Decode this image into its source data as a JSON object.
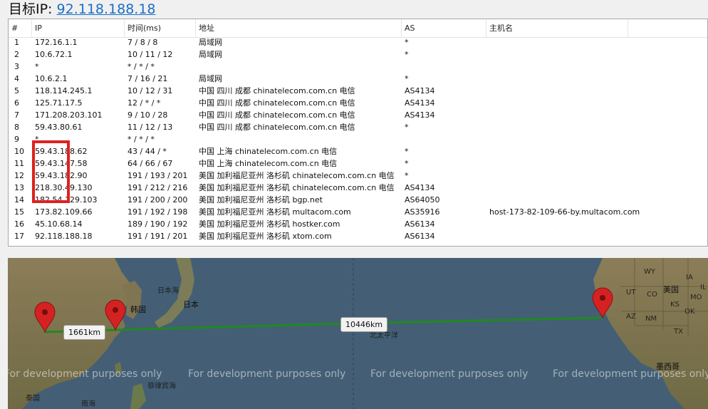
{
  "target": {
    "label": "目标IP:",
    "ip": "92.118.188.18"
  },
  "table": {
    "headers": [
      "#",
      "IP",
      "时间(ms)",
      "地址",
      "AS",
      "主机名"
    ],
    "rows": [
      {
        "n": "1",
        "ip": "172.16.1.1",
        "time": "7 / 8 / 8",
        "addr": "局域网",
        "as": "*",
        "host": ""
      },
      {
        "n": "2",
        "ip": "10.6.72.1",
        "time": "10 / 11 / 12",
        "addr": "局域网",
        "as": "*",
        "host": ""
      },
      {
        "n": "3",
        "ip": "*",
        "time": "* / * / *",
        "addr": "",
        "as": "",
        "host": ""
      },
      {
        "n": "4",
        "ip": "10.6.2.1",
        "time": "7 / 16 / 21",
        "addr": "局域网",
        "as": "*",
        "host": ""
      },
      {
        "n": "5",
        "ip": "118.114.245.1",
        "time": "10 / 12 / 31",
        "addr": "中国 四川 成都 chinatelecom.com.cn 电信",
        "as": "AS4134",
        "host": ""
      },
      {
        "n": "6",
        "ip": "125.71.17.5",
        "time": "12 / * / *",
        "addr": "中国 四川 成都 chinatelecom.com.cn 电信",
        "as": "AS4134",
        "host": ""
      },
      {
        "n": "7",
        "ip": "171.208.203.101",
        "time": "9 / 10 / 28",
        "addr": "中国 四川 成都 chinatelecom.com.cn 电信",
        "as": "AS4134",
        "host": ""
      },
      {
        "n": "8",
        "ip": "59.43.80.61",
        "time": "11 / 12 / 13",
        "addr": "中国 四川 成都 chinatelecom.com.cn 电信",
        "as": "*",
        "host": ""
      },
      {
        "n": "9",
        "ip": "*",
        "time": "* / * / *",
        "addr": "",
        "as": "",
        "host": ""
      },
      {
        "n": "10",
        "ip": "59.43.188.62",
        "time": "43 / 44 / *",
        "addr": "中国 上海 chinatelecom.com.cn 电信",
        "as": "*",
        "host": ""
      },
      {
        "n": "11",
        "ip": "59.43.147.58",
        "time": "64 / 66 / 67",
        "addr": "中国 上海 chinatelecom.com.cn 电信",
        "as": "*",
        "host": ""
      },
      {
        "n": "12",
        "ip": "59.43.182.90",
        "time": "191 / 193 / 201",
        "addr": "美国 加利福尼亚州 洛杉矶 chinatelecom.com.cn 电信",
        "as": "*",
        "host": ""
      },
      {
        "n": "13",
        "ip": "218.30.49.130",
        "time": "191 / 212 / 216",
        "addr": "美国 加利福尼亚州 洛杉矶 chinatelecom.com.cn 电信",
        "as": "AS4134",
        "host": ""
      },
      {
        "n": "14",
        "ip": "182.54.129.103",
        "time": "191 / 200 / 200",
        "addr": "美国 加利福尼亚州 洛杉矶 bgp.net",
        "as": "AS64050",
        "host": ""
      },
      {
        "n": "15",
        "ip": "173.82.109.66",
        "time": "191 / 192 / 198",
        "addr": "美国 加利福尼亚州 洛杉矶 multacom.com",
        "as": "AS35916",
        "host": "host-173-82-109-66-by.multacom.com"
      },
      {
        "n": "16",
        "ip": "45.10.68.14",
        "time": "189 / 190 / 192",
        "addr": "美国 加利福尼亚州 洛杉矶 hostker.com",
        "as": "AS6134",
        "host": ""
      },
      {
        "n": "17",
        "ip": "92.118.188.18",
        "time": "191 / 191 / 201",
        "addr": "美国 加利福尼亚州 洛杉矶 xtom.com",
        "as": "AS6134",
        "host": ""
      }
    ]
  },
  "map": {
    "distances": [
      "1661km",
      "10446km"
    ],
    "watermark": "For development purposes only",
    "labels": [
      "韩国",
      "日本",
      "日本海",
      "北太平洋",
      "美国",
      "墨西哥",
      "泰国",
      "南海",
      "菲律宾海"
    ],
    "state_labels": [
      "WY",
      "UT",
      "CO",
      "AZ",
      "NM",
      "OK",
      "IA",
      "IL",
      "KS",
      "TX",
      "MO"
    ],
    "colors": {
      "water": "#445f75",
      "land": "#8a7a55",
      "route": "#1f8a1f",
      "pin": "#d42222"
    },
    "pin_icon": "map-pin-icon"
  },
  "colors": {
    "link": "#1a6fc4",
    "highlight_box": "#e02020"
  }
}
